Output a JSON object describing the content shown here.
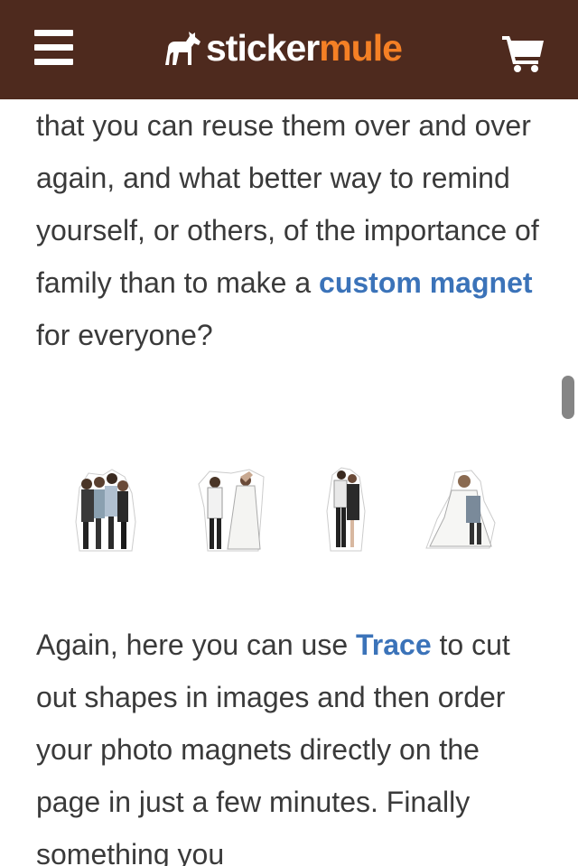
{
  "header": {
    "logo_word1": "sticker",
    "logo_word2": "mule",
    "menu_icon": "hamburger-menu-icon",
    "cart_icon": "shopping-cart-icon",
    "bg_color": "#4e2a1e",
    "accent_color": "#f58025"
  },
  "article": {
    "para1": {
      "text_before_link": "that you can reuse them over and over again, and what better way to remind yourself, or others, of the importance of family than to make a ",
      "link_text": "custom magnet",
      "text_after_link": " for everyone?"
    },
    "para2": {
      "text_before_link": "Again, here you can use ",
      "link_text": "Trace",
      "text_after_link": " to cut out shapes in images and then order your photo magnets directly on the page in just a few minutes. Finally something you"
    },
    "link_color": "#3b73b9",
    "text_color": "#3a3a3a"
  },
  "stickers": [
    {
      "name": "family-group-sticker"
    },
    {
      "name": "couple-dancing-sticker"
    },
    {
      "name": "couple-standing-sticker"
    },
    {
      "name": "couple-hugging-sticker"
    }
  ]
}
